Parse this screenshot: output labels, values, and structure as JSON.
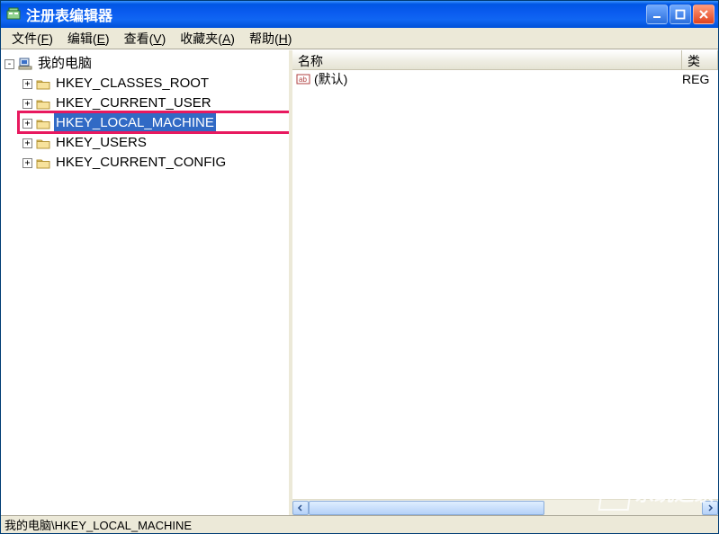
{
  "window": {
    "title": "注册表编辑器"
  },
  "menu": {
    "file": {
      "label": "文件",
      "accel": "F"
    },
    "edit": {
      "label": "编辑",
      "accel": "E"
    },
    "view": {
      "label": "查看",
      "accel": "V"
    },
    "fav": {
      "label": "收藏夹",
      "accel": "A"
    },
    "help": {
      "label": "帮助",
      "accel": "H"
    }
  },
  "tree": {
    "root": {
      "label": "我的电脑",
      "expanded": true
    },
    "hives": [
      {
        "key": "HKEY_CLASSES_ROOT",
        "selected": false
      },
      {
        "key": "HKEY_CURRENT_USER",
        "selected": false
      },
      {
        "key": "HKEY_LOCAL_MACHINE",
        "selected": true
      },
      {
        "key": "HKEY_USERS",
        "selected": false
      },
      {
        "key": "HKEY_CURRENT_CONFIG",
        "selected": false
      }
    ],
    "highlighted_index": 2
  },
  "list": {
    "columns": {
      "name": "名称",
      "type": "类"
    },
    "rows": [
      {
        "name": "(默认)",
        "type": "REG"
      }
    ]
  },
  "statusbar": {
    "path": "我的电脑\\HKEY_LOCAL_MACHINE"
  },
  "watermark": {
    "text": "系统之家"
  }
}
